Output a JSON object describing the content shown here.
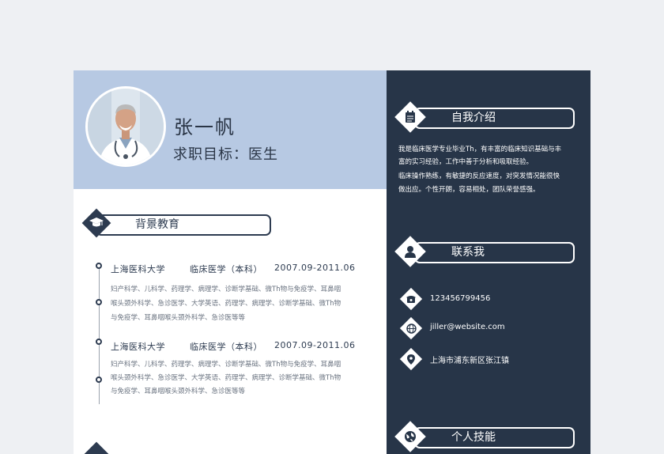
{
  "profile": {
    "name": "张一帆",
    "goal": "求职目标：医生"
  },
  "education": {
    "title": "背景教育",
    "entries": [
      {
        "school": "上海医科大学",
        "major": "临床医学（本科）",
        "period": "2007.09-2011.06",
        "lines": [
          "妇产科学、儿科学、药理学、病理学、诊断学基础、微Th物与免疫学、耳鼻咽",
          "喉头颈外科学、急诊医学、大学英语、药理学、病理学、诊断学基础、微Th物",
          "与免疫学、耳鼻咽喉头颈外科学、急诊医等等"
        ]
      },
      {
        "school": "上海医科大学",
        "major": "临床医学（本科）",
        "period": "2007.09-2011.06",
        "lines": [
          "妇产科学、儿科学、药理学、病理学、诊断学基础、微Th物与免疫学、耳鼻咽",
          "喉头颈外科学、急诊医学、大学英语、药理学、病理学、诊断学基础、微Th物",
          "与免疫学、耳鼻咽喉头颈外科学、急诊医等等"
        ]
      }
    ]
  },
  "intro": {
    "title": "自我介绍",
    "lines": [
      "我是临床医学专业毕业Th，有丰富的临床知识基础与丰",
      "富的实习经验，工作中善于分析和吸取经验。",
      "临床操作熟练，有敏捷的反应速度，对突发情况能很快",
      "做出应。个性开朗，容易相处，团队荣誉感强。"
    ]
  },
  "contact": {
    "title": "联系我",
    "phone": "123456799456",
    "email": "jiller@website.com",
    "address": "上海市浦东新区张江镇"
  },
  "skills": {
    "title": "个人技能"
  },
  "icons": {
    "photo": "doctor-portrait",
    "education": "graduation-cap-icon",
    "intro": "notepad-icon",
    "contact": "person-icon",
    "phone": "phone-icon",
    "email": "globe-icon",
    "address": "location-pin-icon",
    "skills": "globe-icon"
  },
  "colors": {
    "header": "#b7c9e3",
    "sidebar": "#273548",
    "accent": "#2d3b50"
  }
}
